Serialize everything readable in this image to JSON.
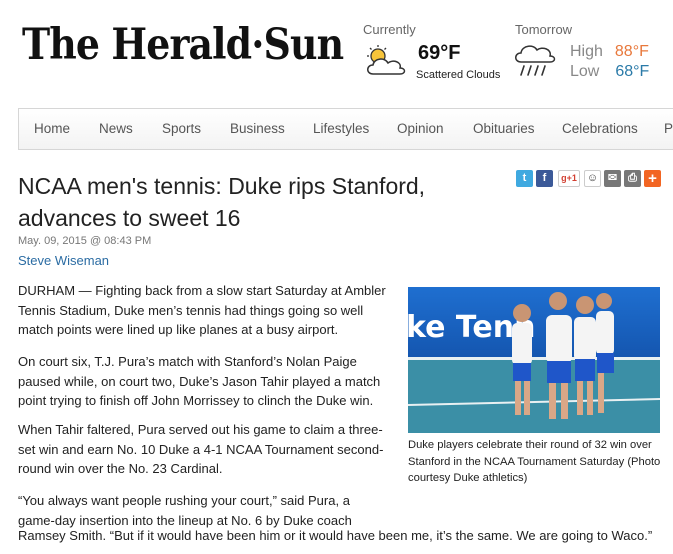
{
  "masthead": {
    "logo_text": "The Herald·Sun"
  },
  "weather": {
    "current_label": "Currently",
    "current_temp": "69°F",
    "current_condition": "Scattered Clouds",
    "current_icon": "partly-cloudy-icon",
    "tomorrow_label": "Tomorrow",
    "tomorrow_icon": "rain-icon",
    "high_label": "High",
    "high_value": "88°F",
    "low_label": "Low",
    "low_value": "68°F",
    "high_color": "#e8783b",
    "low_color": "#2a7aa8"
  },
  "nav": {
    "items": [
      "Home",
      "News",
      "Sports",
      "Business",
      "Lifestyles",
      "Opinion",
      "Obituaries",
      "Celebrations",
      "P"
    ]
  },
  "article": {
    "headline": "NCAA men's tennis: Duke rips Stanford, advances to sweet 16",
    "date": "May. 09, 2015 @ 08:43 PM",
    "author": "Steve Wiseman",
    "paragraphs": [
      "DURHAM — Fighting back from a slow start Saturday at Ambler Tennis Stadium, Duke men’s tennis had things going so well match points were lined up like planes at a busy airport.",
      "On court six, T.J. Pura’s match with Stanford’s Nolan Paige paused while, on court two, Duke’s Jason Tahir played a match point trying to finish off John Morrissey to clinch the Duke win.",
      "When Tahir faltered, Pura served out his game to claim a three-set win and earn No. 10 Duke a 4-1 NCAA Tournament second-round win over the No. 23 Cardinal.",
      "“You always want people rushing your court,” said Pura, a game-day insertion into the lineup at No. 6 by Duke coach Ramsey Smith. “But if it would have been him or it would have been me, it’s the same. We are going to Waco.”"
    ],
    "last_line": "Ramsey Smith. “But if it would have been him or it would have been me, it’s the same. We are going to Waco.”",
    "para4_lines": "“You always want people rushing your court,” said Pura, a game-day insertion into the lineup at No. 6 by Duke coach"
  },
  "photo": {
    "sign_text": "ke Tenn",
    "caption": "Duke players celebrate their round of 32 win over Stanford in the NCAA Tournament Saturday (Photo courtesy Duke athletics)"
  },
  "share": {
    "buttons": [
      {
        "name": "twitter-icon",
        "glyph": "t",
        "color": "#3fa9e0"
      },
      {
        "name": "facebook-icon",
        "glyph": "f",
        "color": "#3b5998"
      },
      {
        "name": "google-plus-icon",
        "glyph": "g+1",
        "color": "#ffffff"
      },
      {
        "name": "reddit-icon",
        "glyph": "☺",
        "color": "#ffffff"
      },
      {
        "name": "email-icon",
        "glyph": "✉",
        "color": "#777777"
      },
      {
        "name": "print-icon",
        "glyph": "⎙",
        "color": "#777777"
      },
      {
        "name": "more-icon",
        "glyph": "+",
        "color": "#f26522"
      }
    ]
  }
}
